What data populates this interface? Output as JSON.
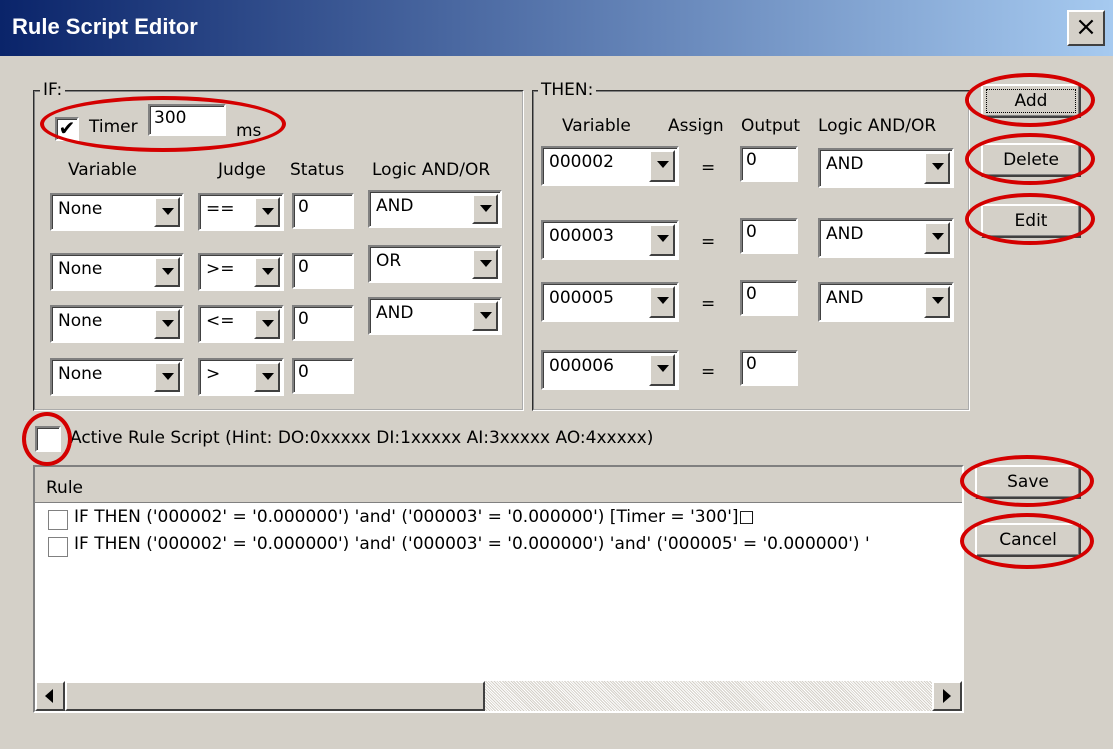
{
  "window": {
    "title": "Rule Script Editor",
    "close_label": "×"
  },
  "if_group": {
    "legend": "IF:",
    "timer": {
      "checked": true,
      "label": "Timer",
      "value": "300",
      "unit": "ms"
    },
    "headers": {
      "variable": "Variable",
      "judge": "Judge",
      "status": "Status",
      "logic": "Logic AND/OR"
    },
    "rows": [
      {
        "variable": "None",
        "judge": "==",
        "status": "0",
        "logic": "AND"
      },
      {
        "variable": "None",
        "judge": ">=",
        "status": "0",
        "logic": "OR"
      },
      {
        "variable": "None",
        "judge": "<=",
        "status": "0",
        "logic": "AND"
      },
      {
        "variable": "None",
        "judge": ">",
        "status": "0"
      }
    ]
  },
  "then_group": {
    "legend": "THEN:",
    "headers": {
      "variable": "Variable",
      "assign": "Assign",
      "output": "Output",
      "logic": "Logic AND/OR"
    },
    "rows": [
      {
        "variable": "000002",
        "assign": "=",
        "output": "0",
        "logic": "AND"
      },
      {
        "variable": "000003",
        "assign": "=",
        "output": "0",
        "logic": "AND"
      },
      {
        "variable": "000005",
        "assign": "=",
        "output": "0",
        "logic": "AND"
      },
      {
        "variable": "000006",
        "assign": "=",
        "output": "0"
      }
    ]
  },
  "buttons": {
    "add": "Add",
    "delete": "Delete",
    "edit": "Edit",
    "save": "Save",
    "cancel": "Cancel"
  },
  "active": {
    "checked": false,
    "label": "Active Rule Script (Hint: DO:0xxxxx  DI:1xxxxx  AI:3xxxxx  AO:4xxxxx)"
  },
  "rule_list": {
    "header": "Rule",
    "items": [
      "IF  THEN ('000002' = '0.000000') 'and' ('000003' = '0.000000') [Timer = '300']□",
      "IF  THEN ('000002' = '0.000000') 'and' ('000003' = '0.000000') 'and' ('000005' = '0.000000') '"
    ]
  },
  "annotation_color": "#d40000"
}
